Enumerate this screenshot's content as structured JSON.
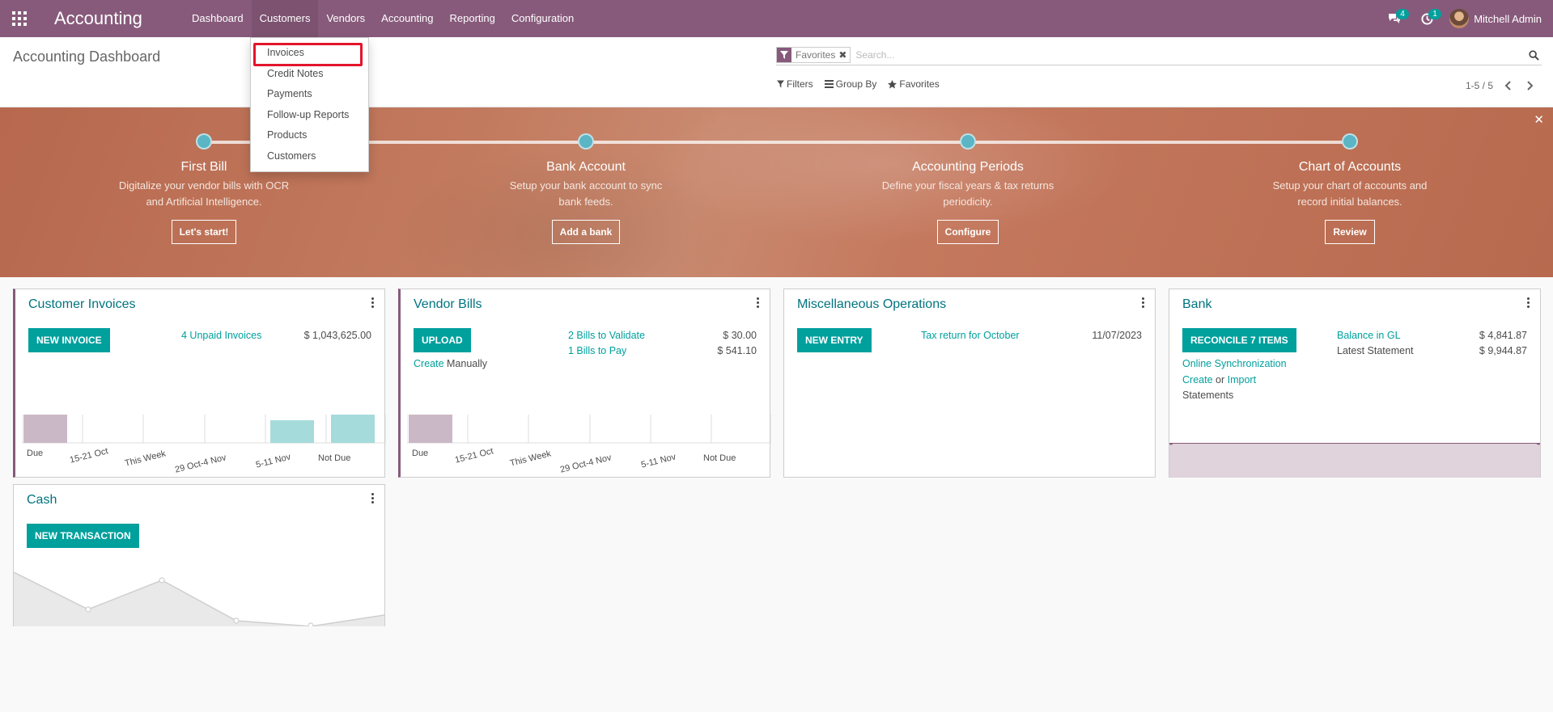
{
  "navbar": {
    "app_name": "Accounting",
    "menu": [
      "Dashboard",
      "Customers",
      "Vendors",
      "Accounting",
      "Reporting",
      "Configuration"
    ],
    "active_menu": "Customers",
    "messages_count": "4",
    "activities_count": "1",
    "user_name": "Mitchell Admin",
    "brand_color": "#875a7b"
  },
  "customers_dropdown": {
    "items": [
      "Invoices",
      "Credit Notes",
      "Payments",
      "Follow-up Reports",
      "Products",
      "Customers"
    ],
    "highlighted": "Invoices"
  },
  "control_panel": {
    "breadcrumb": "Accounting Dashboard",
    "facet_label": "Favorites",
    "search_placeholder": "Search...",
    "filters_label": "Filters",
    "group_by_label": "Group By",
    "favorites_label": "Favorites",
    "pager": "1-5 / 5"
  },
  "onboarding": {
    "steps": [
      {
        "title": "First Bill",
        "desc_line1": "Digitalize your vendor bills with OCR",
        "desc_line2": "and Artificial Intelligence.",
        "button": "Let's start!"
      },
      {
        "title": "Bank Account",
        "desc_line1": "Setup your bank account to sync",
        "desc_line2": "bank feeds.",
        "button": "Add a bank"
      },
      {
        "title": "Accounting Periods",
        "desc_line1": "Define your fiscal years & tax returns",
        "desc_line2": "periodicity.",
        "button": "Configure"
      },
      {
        "title": "Chart of Accounts",
        "desc_line1": "Setup your chart of accounts and",
        "desc_line2": "record initial balances.",
        "button": "Review"
      }
    ]
  },
  "journals": {
    "customer_invoices": {
      "title": "Customer Invoices",
      "button": "NEW INVOICE",
      "unpaid_label": "4 Unpaid Invoices",
      "unpaid_amount": "$ 1,043,625.00",
      "chart_labels": [
        "Due",
        "15-21 Oct",
        "This Week",
        "29 Oct-4 Nov",
        "5-11 Nov",
        "Not Due"
      ]
    },
    "vendor_bills": {
      "title": "Vendor Bills",
      "button": "UPLOAD",
      "validate_label": "2 Bills to Validate",
      "validate_amount": "$ 30.00",
      "pay_label": "1 Bills to Pay",
      "pay_amount": "$ 541.10",
      "create_link": "Create",
      "create_rest": "Manually",
      "chart_labels": [
        "Due",
        "15-21 Oct",
        "This Week",
        "29 Oct-4 Nov",
        "5-11 Nov",
        "Not Due"
      ]
    },
    "misc_operations": {
      "title": "Miscellaneous Operations",
      "button": "NEW ENTRY",
      "tax_label": "Tax return for October",
      "tax_date": "11/07/2023"
    },
    "bank": {
      "title": "Bank",
      "button": "RECONCILE 7 ITEMS",
      "online_sync": "Online Synchronization",
      "create": "Create",
      "or": "or",
      "import": "Import",
      "statements": "Statements",
      "balance_label": "Balance in GL",
      "balance_amount": "$ 4,841.87",
      "latest_label": "Latest Statement",
      "latest_amount": "$ 9,944.87"
    },
    "cash": {
      "title": "Cash",
      "button": "NEW TRANSACTION"
    }
  }
}
